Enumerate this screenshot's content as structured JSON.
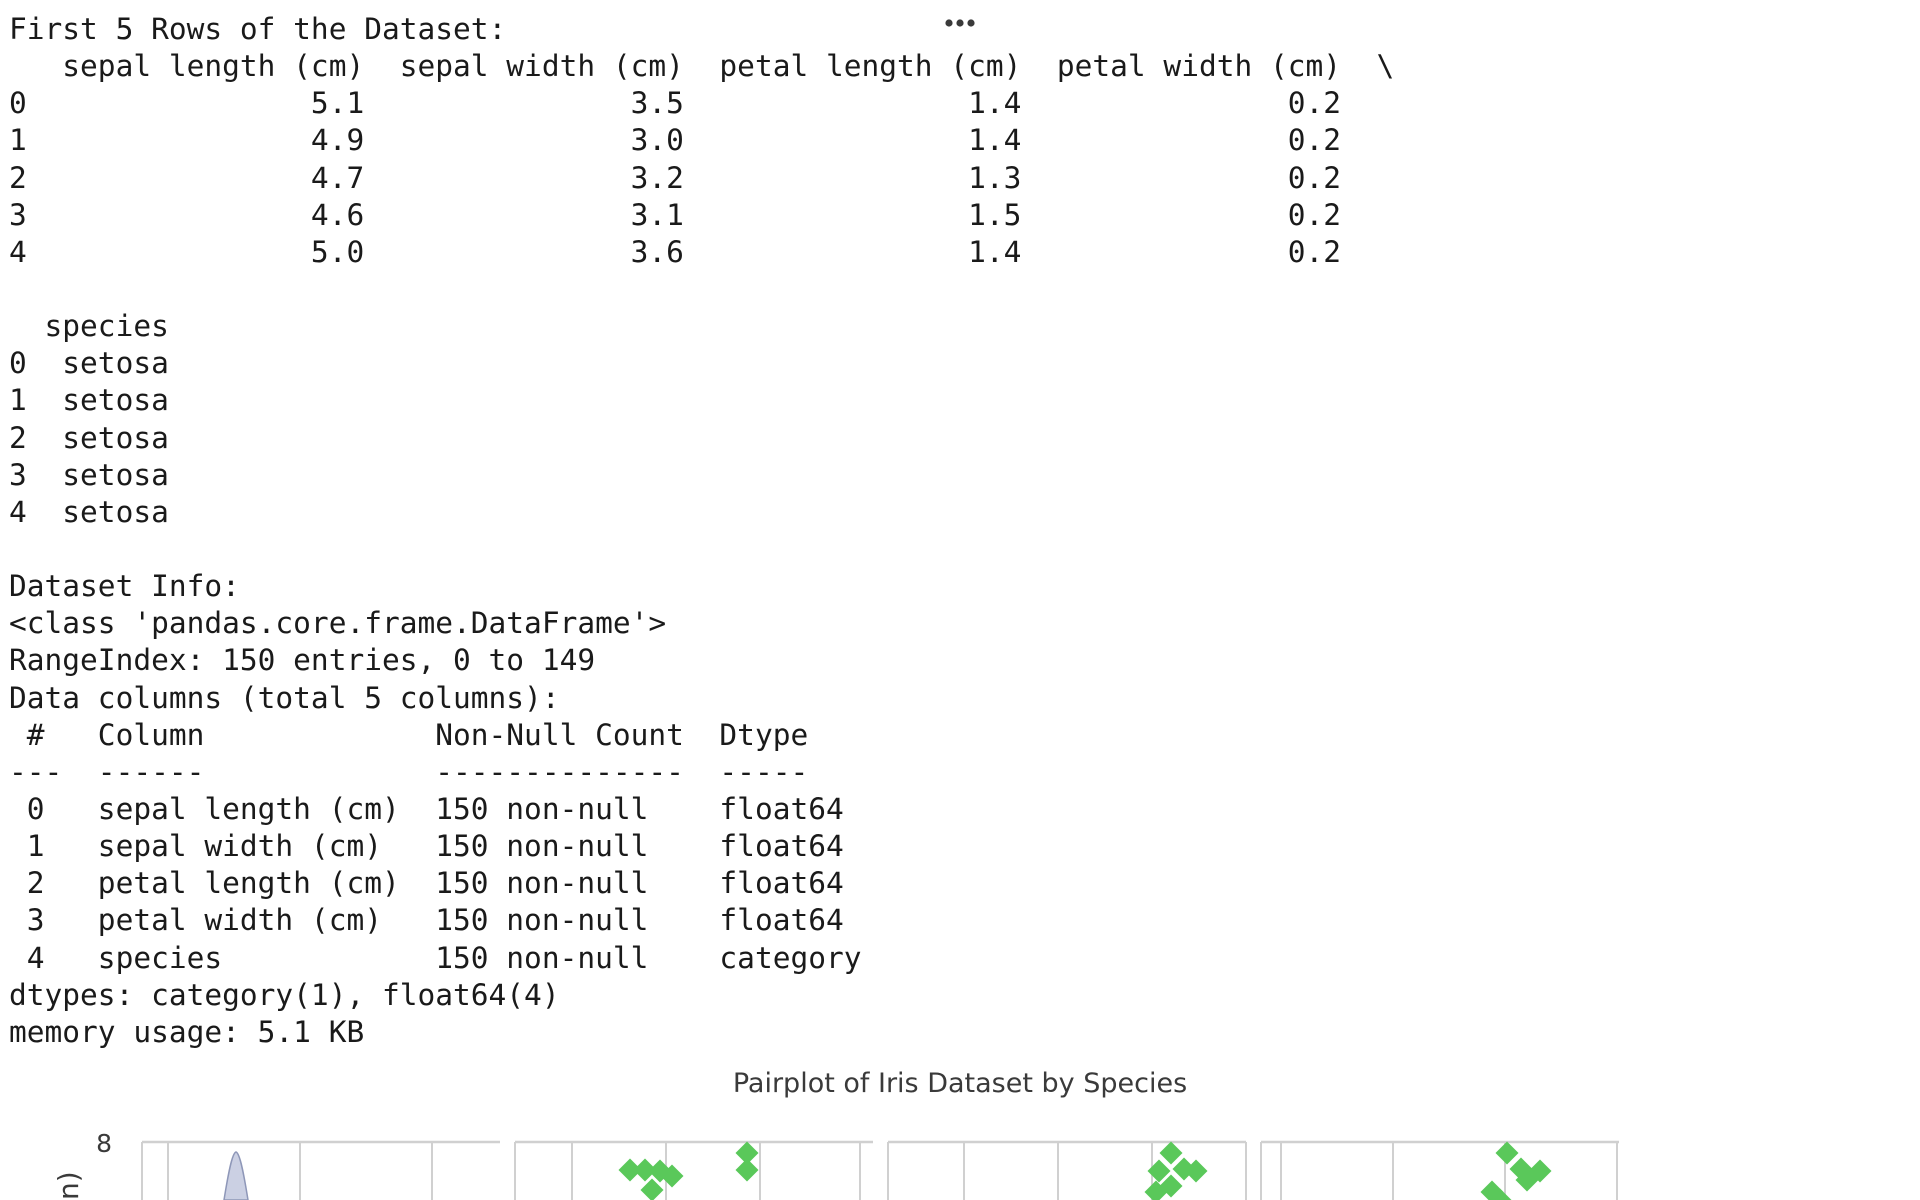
{
  "menu": {
    "more_icon": "more-horizontal-icon"
  },
  "output": {
    "lines": [
      "First 5 Rows of the Dataset:",
      "   sepal length (cm)  sepal width (cm)  petal length (cm)  petal width (cm)  \\",
      "0                5.1               3.5                1.4               0.2   ",
      "1                4.9               3.0                1.4               0.2   ",
      "2                4.7               3.2                1.3               0.2   ",
      "3                4.6               3.1                1.5               0.2   ",
      "4                5.0               3.6                1.4               0.2   ",
      "",
      "  species",
      "0  setosa",
      "1  setosa",
      "2  setosa",
      "3  setosa",
      "4  setosa",
      "",
      "Dataset Info:",
      "<class 'pandas.core.frame.DataFrame'>",
      "RangeIndex: 150 entries, 0 to 149",
      "Data columns (total 5 columns):",
      " #   Column             Non-Null Count  Dtype   ",
      "---  ------             --------------  -----   ",
      " 0   sepal length (cm)  150 non-null    float64 ",
      " 1   sepal width (cm)   150 non-null    float64 ",
      " 2   petal length (cm)  150 non-null    float64 ",
      " 3   petal width (cm)   150 non-null    float64 ",
      " 4   species            150 non-null    category",
      "dtypes: category(1), float64(4)",
      "memory usage: 5.1 KB"
    ]
  },
  "chart": {
    "title": "Pairplot of Iris Dataset by Species",
    "y_tick_label": "8",
    "y_axis_label_partial": "n)",
    "marker_color": "#5ac85a",
    "kde_color": "#c5cbe0",
    "grid_color": "#d0d0d0"
  },
  "chart_data": {
    "type": "scatter",
    "title": "Pairplot of Iris Dataset by Species",
    "y_ticks": [
      8
    ],
    "note": "Only the top edge of the pairplot is visible; first panel shows a diagonal KDE peak, remaining panels show green diamond markers."
  }
}
